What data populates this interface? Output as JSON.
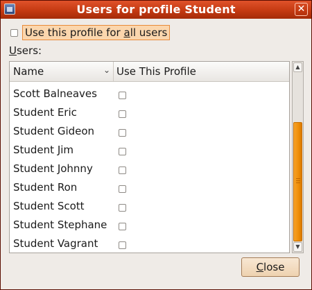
{
  "window": {
    "title": "Users for profile Student",
    "close_glyph": "✕",
    "icon": "app-window-icon"
  },
  "apply_all": {
    "label_pre": "Use this profile for ",
    "label_mnemonic": "a",
    "label_post": "ll users",
    "checked": false
  },
  "users_label": {
    "mnemonic": "U",
    "rest": "sers:"
  },
  "list": {
    "columns": [
      "Name",
      "Use This Profile"
    ],
    "sort_icon": "chevron-down-icon",
    "rows": [
      {
        "name": "Scott Balneaves",
        "checked": false
      },
      {
        "name": "Student Eric",
        "checked": false
      },
      {
        "name": "Student Gideon",
        "checked": false
      },
      {
        "name": "Student Jim",
        "checked": false
      },
      {
        "name": "Student Johnny",
        "checked": false
      },
      {
        "name": "Student Ron",
        "checked": false
      },
      {
        "name": "Student Scott",
        "checked": false
      },
      {
        "name": "Student Stephane",
        "checked": false
      },
      {
        "name": "Student Vagrant",
        "checked": false
      }
    ]
  },
  "close_button": {
    "mnemonic": "C",
    "rest": "lose"
  },
  "colors": {
    "titlebar": "#c43a12",
    "focus": "#fbd6ad",
    "scroll_thumb": "#ef8d08"
  }
}
